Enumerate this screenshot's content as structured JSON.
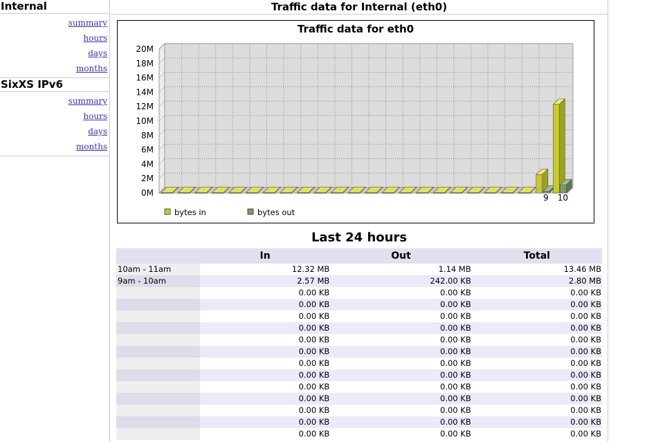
{
  "sidebar": {
    "interfaces": [
      {
        "name": "Internal",
        "links": [
          "summary",
          "hours",
          "days",
          "months"
        ]
      },
      {
        "name": "SixXS IPv6",
        "links": [
          "summary",
          "hours",
          "days",
          "months"
        ]
      }
    ]
  },
  "main": {
    "title": "Traffic data for Internal (eth0)"
  },
  "chart_data": {
    "type": "bar",
    "title": "Traffic data for eth0",
    "categories": [
      "9",
      "10"
    ],
    "series": [
      {
        "name": "bytes in",
        "values": [
          2.57,
          12.32
        ]
      },
      {
        "name": "bytes out",
        "values": [
          0.242,
          1.14
        ]
      }
    ],
    "ytick_labels": [
      "0M",
      "2M",
      "4M",
      "6M",
      "8M",
      "10M",
      "12M",
      "14M",
      "16M",
      "18M",
      "20M"
    ],
    "ylim": [
      0,
      20
    ],
    "legend": "bottom-left",
    "grid": true,
    "colors": {
      "in": "#c8c832",
      "out": "#7e9a6a"
    }
  },
  "table": {
    "title": "Last 24 hours",
    "headers": [
      "",
      "In",
      "Out",
      "Total"
    ],
    "rows": [
      [
        "10am - 11am",
        "12.32 MB",
        "1.14 MB",
        "13.46 MB"
      ],
      [
        "9am - 10am",
        "2.57 MB",
        "242.00 KB",
        "2.80 MB"
      ],
      [
        "",
        "0.00 KB",
        "0.00 KB",
        "0.00 KB"
      ],
      [
        "",
        "0.00 KB",
        "0.00 KB",
        "0.00 KB"
      ],
      [
        "",
        "0.00 KB",
        "0.00 KB",
        "0.00 KB"
      ],
      [
        "",
        "0.00 KB",
        "0.00 KB",
        "0.00 KB"
      ],
      [
        "",
        "0.00 KB",
        "0.00 KB",
        "0.00 KB"
      ],
      [
        "",
        "0.00 KB",
        "0.00 KB",
        "0.00 KB"
      ],
      [
        "",
        "0.00 KB",
        "0.00 KB",
        "0.00 KB"
      ],
      [
        "",
        "0.00 KB",
        "0.00 KB",
        "0.00 KB"
      ],
      [
        "",
        "0.00 KB",
        "0.00 KB",
        "0.00 KB"
      ],
      [
        "",
        "0.00 KB",
        "0.00 KB",
        "0.00 KB"
      ],
      [
        "",
        "0.00 KB",
        "0.00 KB",
        "0.00 KB"
      ],
      [
        "",
        "0.00 KB",
        "0.00 KB",
        "0.00 KB"
      ],
      [
        "",
        "0.00 KB",
        "0.00 KB",
        "0.00 KB"
      ]
    ]
  }
}
